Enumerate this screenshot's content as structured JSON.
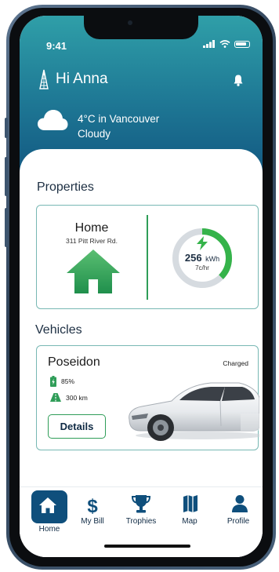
{
  "status_bar": {
    "time": "9:41"
  },
  "header": {
    "greeting": "Hi Anna",
    "weather_line1": "4°C in Vancouver",
    "weather_line2": "Cloudy"
  },
  "properties": {
    "section_title": "Properties",
    "items": [
      {
        "name": "Home",
        "address": "311 Pitt River Rd.",
        "energy_value": "256",
        "energy_unit": "kWh",
        "rate": "7c/hr"
      }
    ]
  },
  "vehicles": {
    "section_title": "Vehicles",
    "items": [
      {
        "name": "Poseidon",
        "status": "Charged",
        "battery": "85%",
        "range": "300 km",
        "details_label": "Details"
      }
    ]
  },
  "tabs": [
    {
      "label": "Home",
      "icon": "home-icon",
      "active": true
    },
    {
      "label": "My Bill",
      "icon": "dollar-icon",
      "active": false
    },
    {
      "label": "Trophies",
      "icon": "trophy-icon",
      "active": false
    },
    {
      "label": "Map",
      "icon": "map-icon",
      "active": false
    },
    {
      "label": "Profile",
      "icon": "person-icon",
      "active": false
    }
  ],
  "colors": {
    "header_top": "#2f9fa8",
    "header_bottom": "#0f4f7c",
    "accent_green": "#2f9d58",
    "card_border": "#78b8b4",
    "navy": "#0f2a44"
  }
}
